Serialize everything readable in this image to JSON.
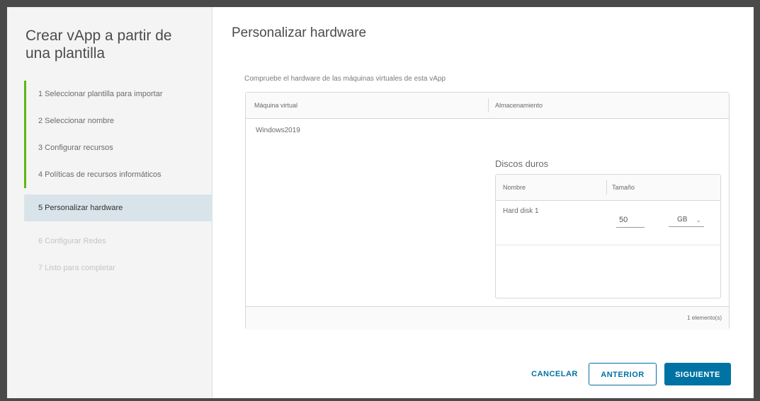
{
  "wizard": {
    "title": "Crear vApp a partir de una plantilla",
    "steps": [
      {
        "label": "1  Seleccionar plantilla para importar",
        "state": "done"
      },
      {
        "label": "2  Seleccionar nombre",
        "state": "done"
      },
      {
        "label": "3  Configurar recursos",
        "state": "done"
      },
      {
        "label": "4  Políticas de recursos informáticos",
        "state": "done"
      },
      {
        "label": "5  Personalizar hardware",
        "state": "active"
      },
      {
        "label": "6  Configurar Redes",
        "state": "disabled"
      },
      {
        "label": "7  Listo para completar",
        "state": "disabled"
      }
    ]
  },
  "page": {
    "title": "Personalizar hardware",
    "description": "Compruebe el hardware de las máquinas virtuales de esta vApp"
  },
  "vm_grid": {
    "columns": [
      "Máquina virtual",
      "Almacenamiento"
    ],
    "rows": [
      {
        "vm_name": "Windows2019"
      }
    ],
    "footer_count": "1 elemento(s)"
  },
  "disks": {
    "label": "Discos duros",
    "columns": [
      "Nombre",
      "Tamaño"
    ],
    "rows": [
      {
        "name": "Hard disk 1",
        "size": "50",
        "unit": "GB"
      }
    ]
  },
  "buttons": {
    "cancel": "CANCELAR",
    "previous": "ANTERIOR",
    "next": "SIGUIENTE"
  },
  "colors": {
    "accent": "#0072a3",
    "step_done": "#5eb715",
    "active_step_bg": "#d9e4ea"
  }
}
